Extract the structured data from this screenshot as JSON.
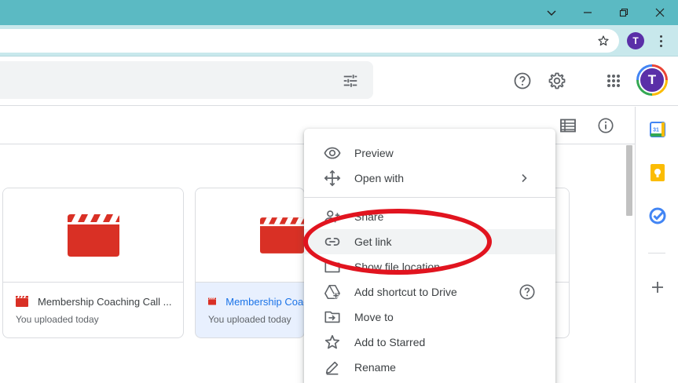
{
  "browser": {
    "profile_initial": "T"
  },
  "drive": {
    "avatar_initial": "T"
  },
  "files": [
    {
      "name": "Membership Coaching Call ...",
      "subtitle": "You uploaded today",
      "selected": false
    },
    {
      "name": "Membership Coaching Call",
      "subtitle": "You uploaded today",
      "selected": true
    }
  ],
  "context_menu": {
    "items": [
      {
        "label": "Preview",
        "icon": "eye-icon"
      },
      {
        "label": "Open with",
        "icon": "move-arrows-icon",
        "submenu": true
      },
      {
        "label": "Share",
        "icon": "person-add-icon"
      },
      {
        "label": "Get link",
        "icon": "link-icon",
        "highlighted": true
      },
      {
        "label": "Show file location",
        "icon": "folder-icon"
      },
      {
        "label": "Add shortcut to Drive",
        "icon": "drive-shortcut-icon",
        "help": true
      },
      {
        "label": "Move to",
        "icon": "move-to-folder-icon"
      },
      {
        "label": "Add to Starred",
        "icon": "star-outline-icon"
      },
      {
        "label": "Rename",
        "icon": "pencil-icon"
      }
    ]
  },
  "colors": {
    "titlebar": "#5bbac3",
    "accent": "#1a73e8",
    "video_red": "#d93025",
    "annotation": "#e1141f"
  }
}
